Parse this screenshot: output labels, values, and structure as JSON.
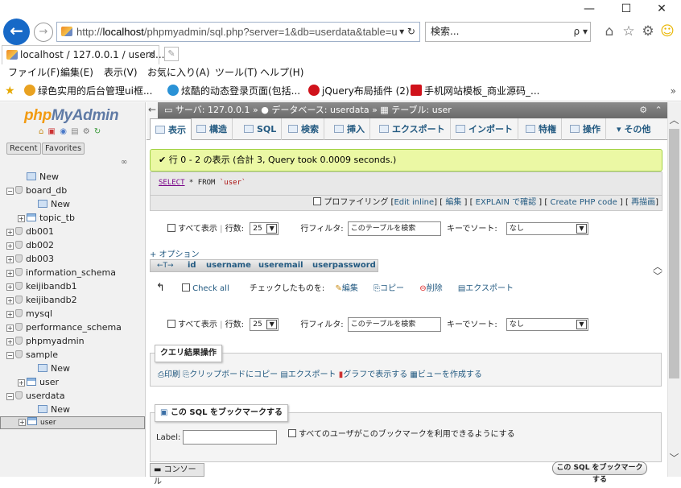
{
  "window": {
    "minimize": "—",
    "maximize": "☐",
    "close": "✕"
  },
  "browser": {
    "url_prefix": "http://",
    "url_host": "localhost",
    "url_rest": "/phpmyadmin/sql.php?server=1&db=userdata&table=u",
    "url_controls": "▾ ↻",
    "search_placeholder": "検索...",
    "search_controls": "ρ ▾",
    "tab_title": "localhost / 127.0.0.1 / userd...",
    "tab_close": "✕",
    "menus": [
      "ファイル(F)",
      "編集(E)",
      "表示(V)",
      "お気に入り(A)",
      "ツール(T)",
      "ヘルプ(H)"
    ],
    "favorites": [
      "绿色实用的后台管理ui框...",
      "炫酷的动态登录页面(包括...",
      "jQuery布局插件 (2)",
      "手机网站模板_商业源码_..."
    ],
    "favorites_more": "»"
  },
  "nav": {
    "logo_php": "php",
    "logo_myadmin": "MyAdmin",
    "tabs": [
      "Recent",
      "Favorites"
    ],
    "link_icon": "∞",
    "tree": [
      {
        "label": "New",
        "indent": 1,
        "kind": "new",
        "exp": ""
      },
      {
        "label": "board_db",
        "indent": 0,
        "kind": "db",
        "exp": "−"
      },
      {
        "label": "New",
        "indent": 2,
        "kind": "new",
        "exp": ""
      },
      {
        "label": "topic_tb",
        "indent": 1,
        "kind": "tbl",
        "exp": "+"
      },
      {
        "label": "db001",
        "indent": 0,
        "kind": "db",
        "exp": "+"
      },
      {
        "label": "db002",
        "indent": 0,
        "kind": "db",
        "exp": "+"
      },
      {
        "label": "db003",
        "indent": 0,
        "kind": "db",
        "exp": "+"
      },
      {
        "label": "information_schema",
        "indent": 0,
        "kind": "db",
        "exp": "+"
      },
      {
        "label": "keijibandb1",
        "indent": 0,
        "kind": "db",
        "exp": "+"
      },
      {
        "label": "keijibandb2",
        "indent": 0,
        "kind": "db",
        "exp": "+"
      },
      {
        "label": "mysql",
        "indent": 0,
        "kind": "db",
        "exp": "+"
      },
      {
        "label": "performance_schema",
        "indent": 0,
        "kind": "db",
        "exp": "+"
      },
      {
        "label": "phpmyadmin",
        "indent": 0,
        "kind": "db",
        "exp": "+"
      },
      {
        "label": "sample",
        "indent": 0,
        "kind": "db",
        "exp": "−"
      },
      {
        "label": "New",
        "indent": 2,
        "kind": "new",
        "exp": ""
      },
      {
        "label": "user",
        "indent": 1,
        "kind": "tbl",
        "exp": "+"
      },
      {
        "label": "userdata",
        "indent": 0,
        "kind": "db",
        "exp": "−"
      },
      {
        "label": "New",
        "indent": 2,
        "kind": "new",
        "exp": ""
      },
      {
        "label": "user",
        "indent": 1,
        "kind": "tbl",
        "exp": "+",
        "selected": true
      }
    ]
  },
  "breadcrumb": {
    "server": "サーバ: 127.0.0.1",
    "database": "データベース: userdata",
    "table": "テーブル: user",
    "sep": "»",
    "right": "⚙ ⌃"
  },
  "tabs": [
    "表示",
    "構造",
    "SQL",
    "検索",
    "挿入",
    "エクスポート",
    "インポート",
    "特権",
    "操作",
    "▾ その他"
  ],
  "result": {
    "success": "✔ 行 0 - 2 の表示 (合計 3, Query took 0.0009 seconds.)",
    "sql_select": "SELECT",
    "sql_from": " * FROM ",
    "sql_table": "`user`",
    "profiling": "プロファイリング",
    "edit_inline": "Edit inline",
    "edit": "編集",
    "explain": "EXPLAIN で確認",
    "create_php": "Create PHP code",
    "refresh": "再描画"
  },
  "navbar": {
    "show_all": "すべて表示",
    "rows_label": "行数:",
    "rows_value": "25",
    "filter_label": "行フィルタ:",
    "filter_placeholder": "このテーブルを検索",
    "sort_label": "キーでソート:",
    "sort_value": "なし"
  },
  "options": "+ オプション",
  "columns": [
    "←T→",
    "id",
    "username",
    "useremail",
    "userpassword"
  ],
  "with_selected": {
    "check_all": "Check all",
    "label": "チェックしたものを:",
    "edit": "編集",
    "copy": "コピー",
    "delete": "削除",
    "export": "エクスポート"
  },
  "query_ops": {
    "legend": "クエリ結果操作",
    "print": "印刷",
    "copy": "クリップボードにコピー",
    "export": "エクスポート",
    "chart": "グラフで表示する",
    "view": "ビューを作成する"
  },
  "bookmark": {
    "legend": "この SQL をブックマークする",
    "label": "Label:",
    "shared": "すべてのユーザがこのブックマークを利用できるようにする",
    "button": "この SQL をブックマークする"
  },
  "console": "▬ コンソール"
}
